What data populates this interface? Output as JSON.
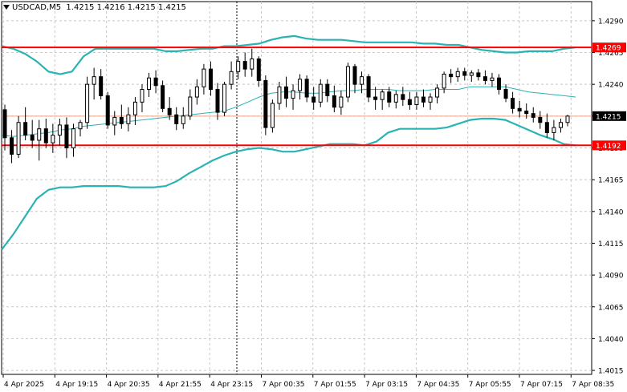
{
  "header": {
    "symbol": "USDCAD,M5",
    "ohlc": "1.4215 1.4216 1.4215 1.4215"
  },
  "chart_data": {
    "type": "candlestick",
    "symbol": "USDCAD",
    "timeframe": "M5",
    "ylim": [
      1.401,
      1.43
    ],
    "y_ticks": [
      "1.4290",
      "1.4265",
      "1.4240",
      "1.4215",
      "1.4190",
      "1.4165",
      "1.4140",
      "1.4115",
      "1.4090",
      "1.4065",
      "1.4040",
      "1.4015"
    ],
    "x_ticks": [
      "4 Apr 2025",
      "4 Apr 19:15",
      "4 Apr 20:35",
      "4 Apr 21:55",
      "4 Apr 23:15",
      "7 Apr 00:35",
      "7 Apr 01:55",
      "7 Apr 03:15",
      "7 Apr 04:35",
      "7 Apr 05:55",
      "7 Apr 07:15",
      "7 Apr 08:35"
    ],
    "horizontal_levels": [
      {
        "price": 1.4269,
        "label": "1.4269",
        "color": "#ff0000"
      },
      {
        "price": 1.4192,
        "label": "1.4192",
        "color": "#ff0000"
      }
    ],
    "current_price": {
      "price": 1.4215,
      "label": "1.4215"
    },
    "bollinger": {
      "color": "#2ab3b3",
      "upper": [
        1.427,
        1.4268,
        1.4264,
        1.4258,
        1.425,
        1.4248,
        1.425,
        1.4262,
        1.4268,
        1.4268,
        1.4268,
        1.4268,
        1.4268,
        1.4268,
        1.4266,
        1.4266,
        1.4267,
        1.4268,
        1.4268,
        1.427,
        1.427,
        1.4271,
        1.4272,
        1.4275,
        1.4277,
        1.4278,
        1.4276,
        1.4275,
        1.4275,
        1.4275,
        1.4274,
        1.4273,
        1.4273,
        1.4273,
        1.4273,
        1.4273,
        1.4272,
        1.4272,
        1.4271,
        1.4271,
        1.4269,
        1.4267,
        1.4266,
        1.4265,
        1.4265,
        1.4266,
        1.4266,
        1.4266,
        1.4268,
        1.4269
      ],
      "middle": [
        1.42,
        1.4199,
        1.42,
        1.4201,
        1.4202,
        1.4204,
        1.4205,
        1.4207,
        1.4208,
        1.4209,
        1.421,
        1.4211,
        1.4212,
        1.4213,
        1.4214,
        1.4215,
        1.4216,
        1.4217,
        1.4218,
        1.4219,
        1.4222,
        1.4226,
        1.423,
        1.4233,
        1.4234,
        1.4234,
        1.4233,
        1.4233,
        1.4234,
        1.4235,
        1.4235,
        1.4236,
        1.4236,
        1.4236,
        1.4235,
        1.4235,
        1.4235,
        1.4236,
        1.4236,
        1.4236,
        1.4238,
        1.4238,
        1.4238,
        1.4238,
        1.4236,
        1.4234,
        1.4233,
        1.4232,
        1.4231,
        1.423
      ],
      "lower": [
        1.411,
        1.4122,
        1.4136,
        1.415,
        1.4157,
        1.4159,
        1.4159,
        1.416,
        1.416,
        1.416,
        1.416,
        1.4159,
        1.4159,
        1.4159,
        1.416,
        1.4164,
        1.417,
        1.4175,
        1.418,
        1.4184,
        1.4187,
        1.4189,
        1.419,
        1.4189,
        1.4187,
        1.4187,
        1.4189,
        1.4191,
        1.4193,
        1.4193,
        1.4193,
        1.4192,
        1.4195,
        1.4202,
        1.4205,
        1.4205,
        1.4205,
        1.4205,
        1.4206,
        1.4209,
        1.4212,
        1.4213,
        1.4213,
        1.4212,
        1.4208,
        1.4204,
        1.42,
        1.4197,
        1.4193,
        1.4192
      ]
    },
    "candles": [
      [
        1.422,
        1.4224,
        1.4188,
        1.4198
      ],
      [
        1.4198,
        1.4204,
        1.4178,
        1.4185
      ],
      [
        1.4185,
        1.4215,
        1.4182,
        1.421
      ],
      [
        1.421,
        1.4222,
        1.4196,
        1.42
      ],
      [
        1.42,
        1.4212,
        1.419,
        1.4196
      ],
      [
        1.4196,
        1.4212,
        1.418,
        1.4205
      ],
      [
        1.4205,
        1.4213,
        1.419,
        1.4194
      ],
      [
        1.4194,
        1.4209,
        1.4186,
        1.42
      ],
      [
        1.42,
        1.4213,
        1.4192,
        1.4208
      ],
      [
        1.4208,
        1.4214,
        1.4182,
        1.419
      ],
      [
        1.419,
        1.4209,
        1.4183,
        1.4205
      ],
      [
        1.4205,
        1.4212,
        1.4199,
        1.421
      ],
      [
        1.421,
        1.4246,
        1.4205,
        1.424
      ],
      [
        1.424,
        1.4253,
        1.4228,
        1.4246
      ],
      [
        1.4246,
        1.4252,
        1.4228,
        1.4231
      ],
      [
        1.4231,
        1.4234,
        1.4205,
        1.4208
      ],
      [
        1.4208,
        1.4219,
        1.42,
        1.4214
      ],
      [
        1.4214,
        1.4224,
        1.4205,
        1.4209
      ],
      [
        1.4209,
        1.4222,
        1.4203,
        1.4216
      ],
      [
        1.4216,
        1.423,
        1.4208,
        1.4226
      ],
      [
        1.4226,
        1.424,
        1.4218,
        1.4236
      ],
      [
        1.4236,
        1.4249,
        1.423,
        1.4245
      ],
      [
        1.4245,
        1.4251,
        1.4233,
        1.4239
      ],
      [
        1.4239,
        1.4243,
        1.4218,
        1.4221
      ],
      [
        1.4221,
        1.423,
        1.4212,
        1.4216
      ],
      [
        1.4216,
        1.4222,
        1.4204,
        1.4209
      ],
      [
        1.4209,
        1.4222,
        1.4205,
        1.4215
      ],
      [
        1.4215,
        1.4236,
        1.4212,
        1.423
      ],
      [
        1.423,
        1.4244,
        1.4224,
        1.4238
      ],
      [
        1.4238,
        1.4256,
        1.4232,
        1.4252
      ],
      [
        1.4252,
        1.4258,
        1.4231,
        1.4236
      ],
      [
        1.4236,
        1.4241,
        1.4212,
        1.4218
      ],
      [
        1.4218,
        1.4242,
        1.4215,
        1.424
      ],
      [
        1.424,
        1.4258,
        1.4236,
        1.425
      ],
      [
        1.425,
        1.4262,
        1.4244,
        1.4258
      ],
      [
        1.4258,
        1.4265,
        1.4246,
        1.4252
      ],
      [
        1.4252,
        1.4268,
        1.4246,
        1.426
      ],
      [
        1.426,
        1.4262,
        1.4238,
        1.4243
      ],
      [
        1.4243,
        1.4247,
        1.42,
        1.4206
      ],
      [
        1.4206,
        1.4228,
        1.4202,
        1.4225
      ],
      [
        1.4225,
        1.4242,
        1.422,
        1.4238
      ],
      [
        1.4238,
        1.4246,
        1.4222,
        1.4229
      ],
      [
        1.4229,
        1.424,
        1.422,
        1.4235
      ],
      [
        1.4235,
        1.4248,
        1.4228,
        1.4244
      ],
      [
        1.4244,
        1.4247,
        1.4226,
        1.423
      ],
      [
        1.423,
        1.4238,
        1.422,
        1.4226
      ],
      [
        1.4226,
        1.4244,
        1.4222,
        1.424
      ],
      [
        1.424,
        1.4244,
        1.4226,
        1.4231
      ],
      [
        1.4231,
        1.4239,
        1.4218,
        1.4222
      ],
      [
        1.4222,
        1.4235,
        1.4216,
        1.423
      ],
      [
        1.423,
        1.4257,
        1.4226,
        1.4254
      ],
      [
        1.4254,
        1.4256,
        1.4233,
        1.424
      ],
      [
        1.424,
        1.425,
        1.4233,
        1.4246
      ],
      [
        1.4246,
        1.4248,
        1.4226,
        1.423
      ],
      [
        1.423,
        1.4238,
        1.422,
        1.4228
      ],
      [
        1.4228,
        1.4236,
        1.422,
        1.4234
      ],
      [
        1.4234,
        1.4238,
        1.4222,
        1.4226
      ],
      [
        1.4226,
        1.4235,
        1.4221,
        1.4232
      ],
      [
        1.4232,
        1.4238,
        1.4223,
        1.4228
      ],
      [
        1.4228,
        1.4234,
        1.422,
        1.4224
      ],
      [
        1.4224,
        1.4234,
        1.422,
        1.423
      ],
      [
        1.423,
        1.4236,
        1.4222,
        1.4226
      ],
      [
        1.4226,
        1.4233,
        1.422,
        1.423
      ],
      [
        1.423,
        1.424,
        1.4225,
        1.4237
      ],
      [
        1.4237,
        1.425,
        1.4233,
        1.4248
      ],
      [
        1.4248,
        1.4252,
        1.4241,
        1.4246
      ],
      [
        1.4246,
        1.4253,
        1.4242,
        1.425
      ],
      [
        1.425,
        1.4253,
        1.4243,
        1.4247
      ],
      [
        1.4247,
        1.4251,
        1.4242,
        1.4249
      ],
      [
        1.4249,
        1.4252,
        1.4243,
        1.4246
      ],
      [
        1.4246,
        1.4251,
        1.424,
        1.4243
      ],
      [
        1.4243,
        1.4249,
        1.4238,
        1.4245
      ],
      [
        1.4245,
        1.4248,
        1.4232,
        1.4236
      ],
      [
        1.4236,
        1.424,
        1.4226,
        1.4229
      ],
      [
        1.4229,
        1.4234,
        1.4217,
        1.4221
      ],
      [
        1.4221,
        1.4227,
        1.4214,
        1.4219
      ],
      [
        1.4219,
        1.4225,
        1.4213,
        1.4217
      ],
      [
        1.4217,
        1.4222,
        1.421,
        1.4214
      ],
      [
        1.4214,
        1.4219,
        1.4205,
        1.421
      ],
      [
        1.421,
        1.4217,
        1.4198,
        1.4202
      ],
      [
        1.4202,
        1.4212,
        1.4196,
        1.4206
      ],
      [
        1.4206,
        1.4213,
        1.4202,
        1.421
      ],
      [
        1.421,
        1.4216,
        1.4207,
        1.4215
      ]
    ]
  }
}
